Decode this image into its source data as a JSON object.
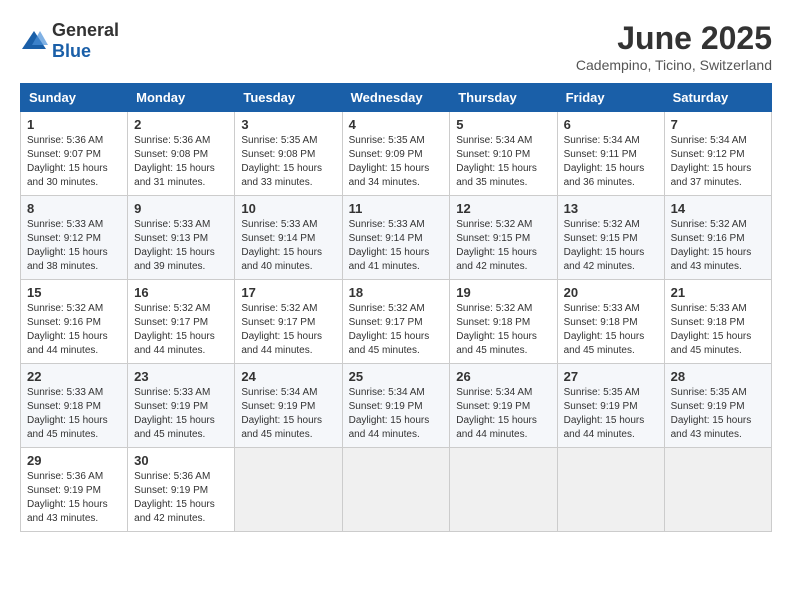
{
  "logo": {
    "general": "General",
    "blue": "Blue"
  },
  "title": "June 2025",
  "subtitle": "Cadempino, Ticino, Switzerland",
  "weekdays": [
    "Sunday",
    "Monday",
    "Tuesday",
    "Wednesday",
    "Thursday",
    "Friday",
    "Saturday"
  ],
  "weeks": [
    [
      {
        "day": "1",
        "info": "Sunrise: 5:36 AM\nSunset: 9:07 PM\nDaylight: 15 hours\nand 30 minutes."
      },
      {
        "day": "2",
        "info": "Sunrise: 5:36 AM\nSunset: 9:08 PM\nDaylight: 15 hours\nand 31 minutes."
      },
      {
        "day": "3",
        "info": "Sunrise: 5:35 AM\nSunset: 9:08 PM\nDaylight: 15 hours\nand 33 minutes."
      },
      {
        "day": "4",
        "info": "Sunrise: 5:35 AM\nSunset: 9:09 PM\nDaylight: 15 hours\nand 34 minutes."
      },
      {
        "day": "5",
        "info": "Sunrise: 5:34 AM\nSunset: 9:10 PM\nDaylight: 15 hours\nand 35 minutes."
      },
      {
        "day": "6",
        "info": "Sunrise: 5:34 AM\nSunset: 9:11 PM\nDaylight: 15 hours\nand 36 minutes."
      },
      {
        "day": "7",
        "info": "Sunrise: 5:34 AM\nSunset: 9:12 PM\nDaylight: 15 hours\nand 37 minutes."
      }
    ],
    [
      {
        "day": "8",
        "info": "Sunrise: 5:33 AM\nSunset: 9:12 PM\nDaylight: 15 hours\nand 38 minutes."
      },
      {
        "day": "9",
        "info": "Sunrise: 5:33 AM\nSunset: 9:13 PM\nDaylight: 15 hours\nand 39 minutes."
      },
      {
        "day": "10",
        "info": "Sunrise: 5:33 AM\nSunset: 9:14 PM\nDaylight: 15 hours\nand 40 minutes."
      },
      {
        "day": "11",
        "info": "Sunrise: 5:33 AM\nSunset: 9:14 PM\nDaylight: 15 hours\nand 41 minutes."
      },
      {
        "day": "12",
        "info": "Sunrise: 5:32 AM\nSunset: 9:15 PM\nDaylight: 15 hours\nand 42 minutes."
      },
      {
        "day": "13",
        "info": "Sunrise: 5:32 AM\nSunset: 9:15 PM\nDaylight: 15 hours\nand 42 minutes."
      },
      {
        "day": "14",
        "info": "Sunrise: 5:32 AM\nSunset: 9:16 PM\nDaylight: 15 hours\nand 43 minutes."
      }
    ],
    [
      {
        "day": "15",
        "info": "Sunrise: 5:32 AM\nSunset: 9:16 PM\nDaylight: 15 hours\nand 44 minutes."
      },
      {
        "day": "16",
        "info": "Sunrise: 5:32 AM\nSunset: 9:17 PM\nDaylight: 15 hours\nand 44 minutes."
      },
      {
        "day": "17",
        "info": "Sunrise: 5:32 AM\nSunset: 9:17 PM\nDaylight: 15 hours\nand 44 minutes."
      },
      {
        "day": "18",
        "info": "Sunrise: 5:32 AM\nSunset: 9:17 PM\nDaylight: 15 hours\nand 45 minutes."
      },
      {
        "day": "19",
        "info": "Sunrise: 5:32 AM\nSunset: 9:18 PM\nDaylight: 15 hours\nand 45 minutes."
      },
      {
        "day": "20",
        "info": "Sunrise: 5:33 AM\nSunset: 9:18 PM\nDaylight: 15 hours\nand 45 minutes."
      },
      {
        "day": "21",
        "info": "Sunrise: 5:33 AM\nSunset: 9:18 PM\nDaylight: 15 hours\nand 45 minutes."
      }
    ],
    [
      {
        "day": "22",
        "info": "Sunrise: 5:33 AM\nSunset: 9:18 PM\nDaylight: 15 hours\nand 45 minutes."
      },
      {
        "day": "23",
        "info": "Sunrise: 5:33 AM\nSunset: 9:19 PM\nDaylight: 15 hours\nand 45 minutes."
      },
      {
        "day": "24",
        "info": "Sunrise: 5:34 AM\nSunset: 9:19 PM\nDaylight: 15 hours\nand 45 minutes."
      },
      {
        "day": "25",
        "info": "Sunrise: 5:34 AM\nSunset: 9:19 PM\nDaylight: 15 hours\nand 44 minutes."
      },
      {
        "day": "26",
        "info": "Sunrise: 5:34 AM\nSunset: 9:19 PM\nDaylight: 15 hours\nand 44 minutes."
      },
      {
        "day": "27",
        "info": "Sunrise: 5:35 AM\nSunset: 9:19 PM\nDaylight: 15 hours\nand 44 minutes."
      },
      {
        "day": "28",
        "info": "Sunrise: 5:35 AM\nSunset: 9:19 PM\nDaylight: 15 hours\nand 43 minutes."
      }
    ],
    [
      {
        "day": "29",
        "info": "Sunrise: 5:36 AM\nSunset: 9:19 PM\nDaylight: 15 hours\nand 43 minutes."
      },
      {
        "day": "30",
        "info": "Sunrise: 5:36 AM\nSunset: 9:19 PM\nDaylight: 15 hours\nand 42 minutes."
      },
      {
        "day": "",
        "info": ""
      },
      {
        "day": "",
        "info": ""
      },
      {
        "day": "",
        "info": ""
      },
      {
        "day": "",
        "info": ""
      },
      {
        "day": "",
        "info": ""
      }
    ]
  ]
}
